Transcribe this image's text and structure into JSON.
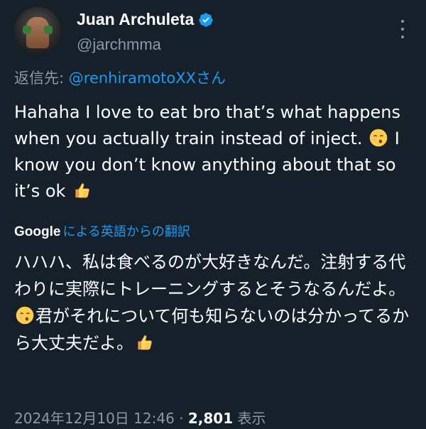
{
  "author": {
    "display_name": "Juan Archuleta",
    "handle": "@jarchmma",
    "verified": true
  },
  "reply": {
    "label": "返信先: ",
    "handle": "@renhiramotoXXさん"
  },
  "tweet": {
    "text_part1": "Hahaha I love to eat bro that’s what happens when you actually train instead of inject. ",
    "text_part2": " I know you don’t know anything about that so it’s ok ",
    "emoji1": "kissing-face",
    "emoji2": "thumbs-up"
  },
  "translation": {
    "provider": "Google",
    "label": "による英語からの翻訳",
    "text_part1": "ハハハ、私は食べるのが大好きなんだ。注射する代わりに実際にトレーニングするとそうなるんだよ。",
    "text_part2": "君がそれについて何も知らないのは分かってるから大丈夫だよ。"
  },
  "meta": {
    "timestamp": "2024年12月10日 12:46",
    "separator": " · ",
    "views_count": "2,801",
    "views_label": " 表示"
  },
  "colors": {
    "background": "#15202b",
    "accent": "#1d9bf0",
    "secondary_text": "#8b98a5"
  }
}
